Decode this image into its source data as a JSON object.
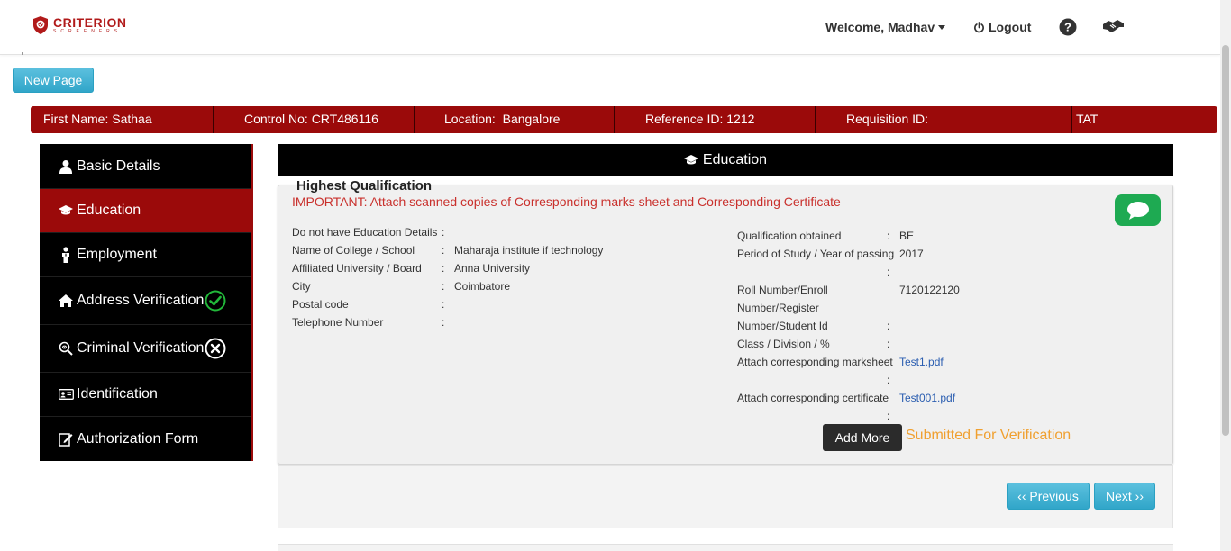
{
  "brand": {
    "name": "CRITERION",
    "tagline": "SCREENERS"
  },
  "header": {
    "welcome": "Welcome, Madhav",
    "logout": "Logout"
  },
  "toolbar": {
    "new_page": "New Page"
  },
  "infobar": {
    "first_name": "First Name: Sathaa",
    "control_no": "Control No: CRT486116",
    "location_label": "Location:",
    "location_value": "Bangalore",
    "reference_id": "Reference ID: 1212",
    "requisition_id": "Requisition ID:",
    "tat": "TAT"
  },
  "sidebar": {
    "items": [
      {
        "label": "Basic Details",
        "icon": "user-icon"
      },
      {
        "label": "Education",
        "icon": "graduation-cap-icon",
        "active": true
      },
      {
        "label": "Employment",
        "icon": "person-tie-icon"
      },
      {
        "label": "Address Verification",
        "icon": "home-icon",
        "status": "verified"
      },
      {
        "label": "Criminal Verification",
        "icon": "fingerprint-search-icon",
        "status": "rejected"
      },
      {
        "label": "Identification",
        "icon": "id-card-icon"
      },
      {
        "label": "Authorization Form",
        "icon": "edit-form-icon"
      }
    ]
  },
  "section": {
    "title": "Education"
  },
  "education": {
    "title": "Highest Qualification",
    "important": "IMPORTANT: Attach scanned copies of Corresponding marks sheet and Corresponding Certificate",
    "left": [
      {
        "label": "Do not have Education Details",
        "colon": ":",
        "value": ""
      },
      {
        "label": "Name of College / School",
        "colon": ":",
        "value": "Maharaja institute if technology"
      },
      {
        "label": "Affiliated University / Board",
        "colon": ":",
        "value": "Anna University"
      },
      {
        "label": "City",
        "colon": ":",
        "value": "Coimbatore"
      },
      {
        "label": "Postal code",
        "colon": ":",
        "value": ""
      },
      {
        "label": "Telephone Number",
        "colon": ":",
        "value": ""
      }
    ],
    "right": {
      "qualification_label": "Qualification obtained",
      "qualification_value": "BE",
      "period_label": "Period of Study / Year of passing",
      "period_value": "2017",
      "roll_label_1": "Roll Number/Enroll",
      "roll_label_2": "Number/Register",
      "roll_label_3": "Number/Student Id",
      "roll_value": "7120122120",
      "class_label": "Class / Division / %",
      "class_value": "",
      "marksheet_label": "Attach corresponding marksheet",
      "marksheet_value": "Test1.pdf",
      "certificate_label": "Attach corresponding certificate",
      "certificate_value": "Test001.pdf",
      "colon": ":"
    },
    "add_more": "Add More",
    "status": "Submitted For Verification"
  },
  "pager": {
    "previous": "‹‹ Previous",
    "next": "Next ››"
  },
  "colors": {
    "brand_red": "#9b0a0a",
    "accent_blue": "#31a6c9",
    "success_green": "#1eaa52",
    "warning_orange": "#f0a030"
  }
}
